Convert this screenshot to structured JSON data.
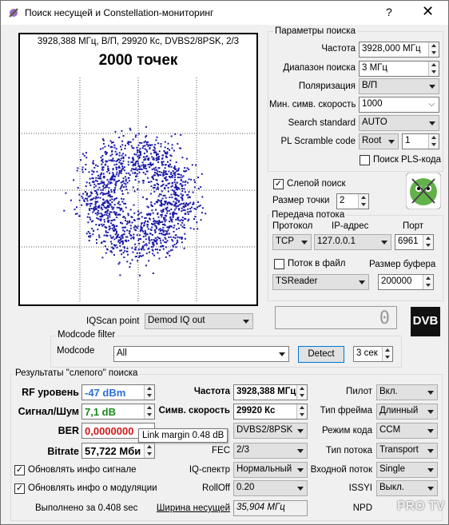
{
  "window": {
    "title": "Поиск несущей и Constellation-мониторинг",
    "help": "?",
    "close": "✕"
  },
  "constellation": {
    "info": "3928,388 МГц, В/П, 29920 Кс, DVBS2/8PSK, 2/3",
    "points_label": "2000 точек",
    "point_color": "#1a1aa8"
  },
  "iqscan": {
    "label": "IQScan point",
    "value": "Demod IQ out"
  },
  "modcode_filter": {
    "group": "Modcode filter",
    "label": "Modcode",
    "value": "All",
    "detect": "Detect",
    "timeout": "3 сек"
  },
  "search": {
    "group": "Параметры поиска",
    "freq_label": "Частота",
    "freq_value": "3928,000 МГц",
    "range_label": "Диапазон поиска",
    "range_value": "3 МГц",
    "pol_label": "Поляризация",
    "pol_value": "В/П",
    "minsr_label": "Мин. симв. скорость",
    "minsr_value": "1000",
    "std_label": "Search standard",
    "std_value": "AUTO",
    "pls_label": "PL Scramble code",
    "pls_mode": "Root",
    "pls_value": "1",
    "pls_search": "Поиск PLS-кода"
  },
  "blind": {
    "label": "Слепой поиск",
    "checked": "✓",
    "size_label": "Размер точки",
    "size_value": "2"
  },
  "stream": {
    "group": "Передача потока",
    "proto_label": "Протокол",
    "proto_value": "TCP",
    "ip_label": "IP-адрес",
    "ip_value": "127.0.0.1",
    "port_label": "Порт",
    "port_value": "6961",
    "file_label": "Поток в файл",
    "reader_value": "TSReader",
    "buf_label": "Размер буфера",
    "buf_value": "200000"
  },
  "counter": "0",
  "dvb_logo": "DVB",
  "results": {
    "group": "Результаты \"слепого\" поиска",
    "rf_label": "RF уровень",
    "rf_value": "-47 dBm",
    "snr_label": "Сигнал/Шум",
    "snr_value": "7,1 dB",
    "ber_label": "BER",
    "ber_value": "0,0000000",
    "bitrate_label": "Bitrate",
    "bitrate_value": "57,722 Мби",
    "tooltip": "Link margin 0.48 dB",
    "freq_label": "Частота",
    "freq_value": "3928,388 МГц",
    "sr_label": "Симв. скорость",
    "sr_value": "29920 Кс",
    "mod_value": "DVBS2/8PSK",
    "fec_label": "FEC",
    "fec_value": "2/3",
    "iq_label": "IQ-спектр",
    "iq_value": "Нормальный",
    "rolloff_label": "RollOff",
    "rolloff_value": "0.20",
    "bw_label": "Ширина несущей",
    "bw_value": "35,904 МГц",
    "pilot_label": "Пилот",
    "pilot_value": "Вкл.",
    "frame_label": "Тип фрейма",
    "frame_value": "Длинный",
    "code_label": "Режим кода",
    "code_value": "CCM",
    "stype_label": "Тип потока",
    "stype_value": "Transport",
    "input_label": "Входной поток",
    "input_value": "Single",
    "issyi_label": "ISSYI",
    "issyi_value": "Выкл.",
    "npd_label": "NPD",
    "upd_signal": "Обновлять инфо сигнале",
    "upd_mod": "Обновлять инфо о модуляции",
    "done": "Выполнено за 0.408 sec"
  },
  "watermark": "PRO TV"
}
